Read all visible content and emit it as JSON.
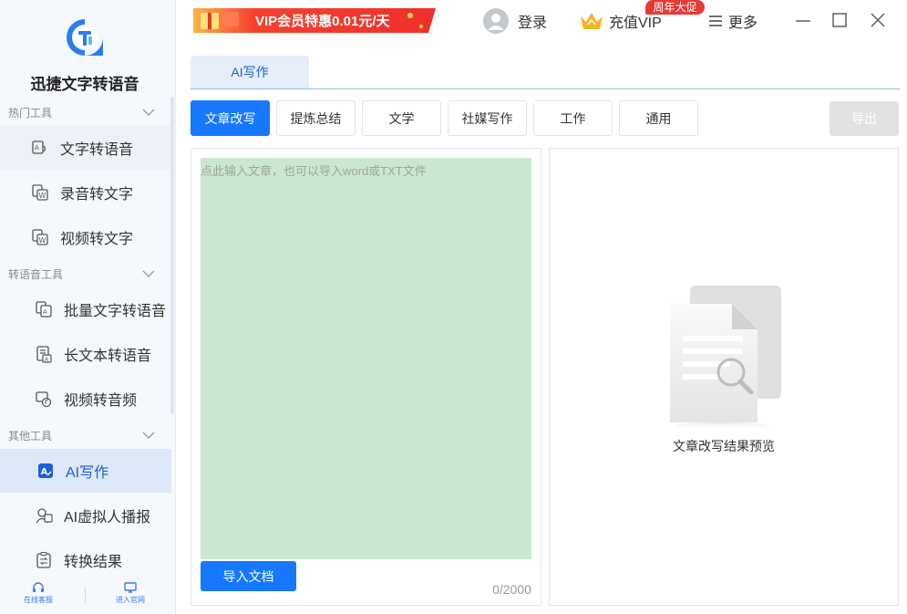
{
  "app": {
    "name": "迅捷文字转语音"
  },
  "sidebar": {
    "sections": [
      {
        "title": "热门工具",
        "items": [
          {
            "label": "文字转语音",
            "icon": "text-to-speech-icon"
          },
          {
            "label": "录音转文字",
            "icon": "audio-to-text-icon"
          },
          {
            "label": "视频转文字",
            "icon": "video-to-text-icon"
          }
        ]
      },
      {
        "title": "转语音工具",
        "items": [
          {
            "label": "批量文字转语音",
            "icon": "batch-tts-icon"
          },
          {
            "label": "长文本转语音",
            "icon": "long-text-tts-icon"
          },
          {
            "label": "视频转音频",
            "icon": "video-to-audio-icon"
          }
        ]
      },
      {
        "title": "其他工具",
        "items": [
          {
            "label": "AI写作",
            "icon": "ai-writing-icon",
            "active": true
          },
          {
            "label": "AI虚拟人播报",
            "icon": "ai-avatar-icon"
          },
          {
            "label": "转换结果",
            "icon": "results-icon"
          }
        ]
      }
    ],
    "footer": {
      "support": "在线客服",
      "website": "进入官网"
    }
  },
  "topbar": {
    "promo_banner": "VIP会员特惠0.01元/天",
    "login": "登录",
    "vip": "充值VIP",
    "vip_badge": "周年大促",
    "more": "更多"
  },
  "tabs": [
    {
      "label": "AI写作",
      "active": true
    }
  ],
  "categories": [
    "文章改写",
    "提炼总结",
    "文学",
    "社媒写作",
    "工作",
    "通用"
  ],
  "export_label": "导出",
  "editor": {
    "placeholder": "点此输入文章，也可以导入word或TXT文件",
    "import_label": "导入文档",
    "counter": "0/2000"
  },
  "preview": {
    "label": "文章改写结果预览"
  },
  "colors": {
    "accent": "#1677ff",
    "editor_bg": "#cce7cf",
    "active_nav_bg": "#dde8f8",
    "badge": "#e53a35"
  }
}
